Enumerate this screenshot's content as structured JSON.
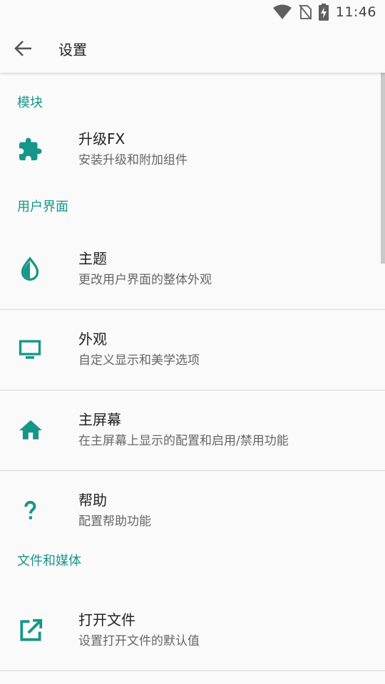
{
  "status": {
    "time": "11:46"
  },
  "app_bar": {
    "title": "设置"
  },
  "sections": {
    "modules": {
      "header": "模块",
      "upgrade": {
        "title": "升级FX",
        "summary": "安装升级和附加组件"
      }
    },
    "ui": {
      "header": "用户界面",
      "theme": {
        "title": "主题",
        "summary": "更改用户界面的整体外观"
      },
      "appearance": {
        "title": "外观",
        "summary": "自定义显示和美学选项"
      },
      "home": {
        "title": "主屏幕",
        "summary": "在主屏幕上显示的配置和启用/禁用功能"
      },
      "help": {
        "title": "帮助",
        "summary": "配置帮助功能"
      }
    },
    "files": {
      "header": "文件和媒体",
      "open_files": {
        "title": "打开文件",
        "summary": "设置打开文件的默认值"
      }
    }
  },
  "colors": {
    "accent": "#16968a",
    "background": "#fafafa"
  },
  "icons": [
    "puzzle-icon",
    "water-drop-icon",
    "monitor-icon",
    "home-icon",
    "question-icon",
    "open-external-icon"
  ]
}
